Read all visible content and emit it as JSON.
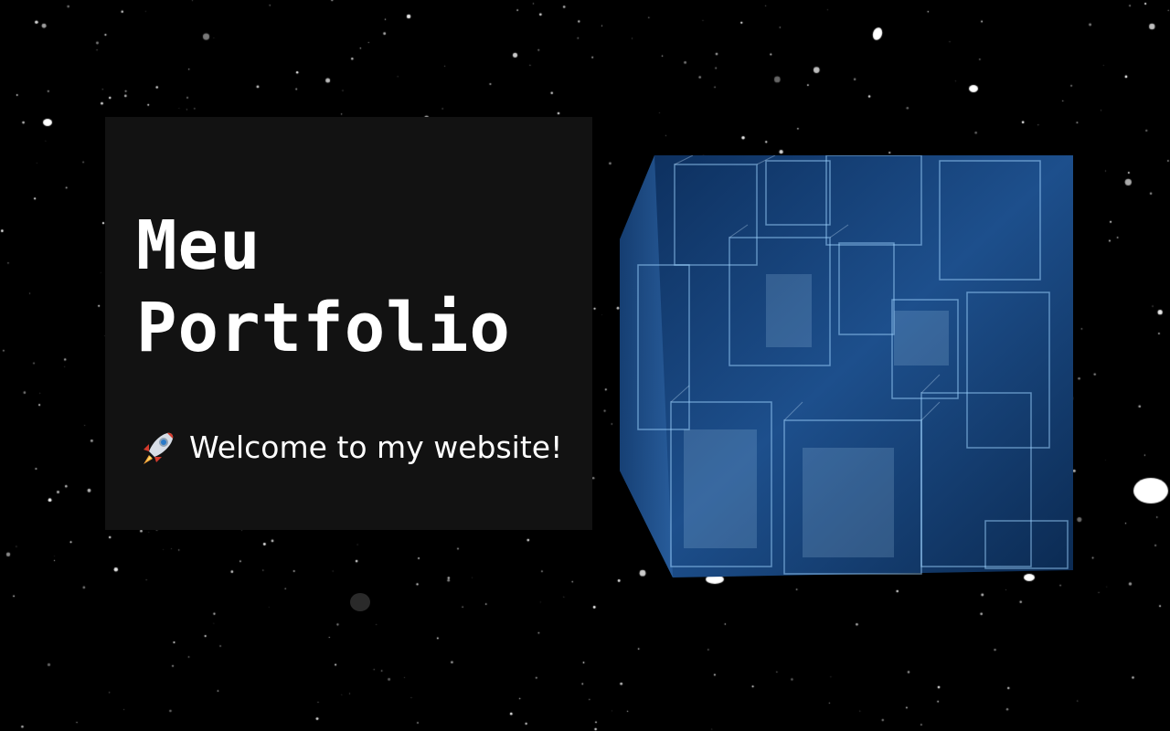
{
  "hero": {
    "title_line1": "Meu",
    "title_line2": "Portfolio",
    "welcome": "Welcome to my website!",
    "welcome_icon": "rocket-icon"
  },
  "visual": {
    "cube_image": "digital-cube-graphic",
    "background": "starfield"
  },
  "colors": {
    "background": "#000000",
    "card": "#121212",
    "text": "#ffffff",
    "cube_accent": "#2f6db3"
  }
}
